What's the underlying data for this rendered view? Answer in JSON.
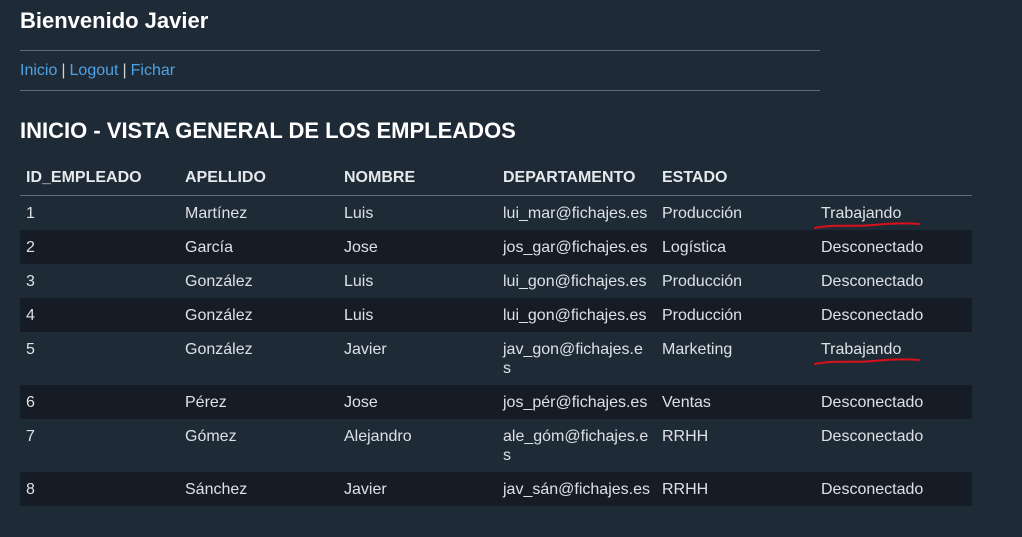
{
  "header": {
    "welcome": "Bienvenido Javier"
  },
  "nav": {
    "inicio": "Inicio",
    "sep1": "|",
    "logout": "Logout",
    "sep2": "|",
    "fichar": "Fichar"
  },
  "page_title": "INICIO - VISTA GENERAL DE LOS EMPLEADOS",
  "table": {
    "headers": [
      "ID_EMPLEADO",
      "APELLIDO",
      "NOMBRE",
      "DEPARTAMENTO",
      "ESTADO",
      ""
    ],
    "rows": [
      [
        "1",
        "Martínez",
        "Luis",
        "lui_mar@fichajes.es",
        "Producción",
        "Trabajando"
      ],
      [
        "2",
        "García",
        "Jose",
        "jos_gar@fichajes.es",
        "Logística",
        "Desconectado"
      ],
      [
        "3",
        "González",
        "Luis",
        "lui_gon@fichajes.es",
        "Producción",
        "Desconectado"
      ],
      [
        "4",
        "González",
        "Luis",
        "lui_gon@fichajes.es",
        "Producción",
        "Desconectado"
      ],
      [
        "5",
        "González",
        "Javier",
        "jav_gon@fichajes.es",
        "Marketing",
        "Trabajando"
      ],
      [
        "6",
        "Pérez",
        "Jose",
        "jos_pér@fichajes.es",
        "Ventas",
        "Desconectado"
      ],
      [
        "7",
        "Gómez",
        "Alejandro",
        "ale_góm@fichajes.es",
        "RRHH",
        "Desconectado"
      ],
      [
        "8",
        "Sánchez",
        "Javier",
        "jav_sán@fichajes.es",
        "RRHH",
        "Desconectado"
      ]
    ]
  },
  "colors": {
    "background": "#1f2a37",
    "alt_row": "#151c25",
    "link": "#4ea2e6",
    "annotation": "#d9101a"
  }
}
